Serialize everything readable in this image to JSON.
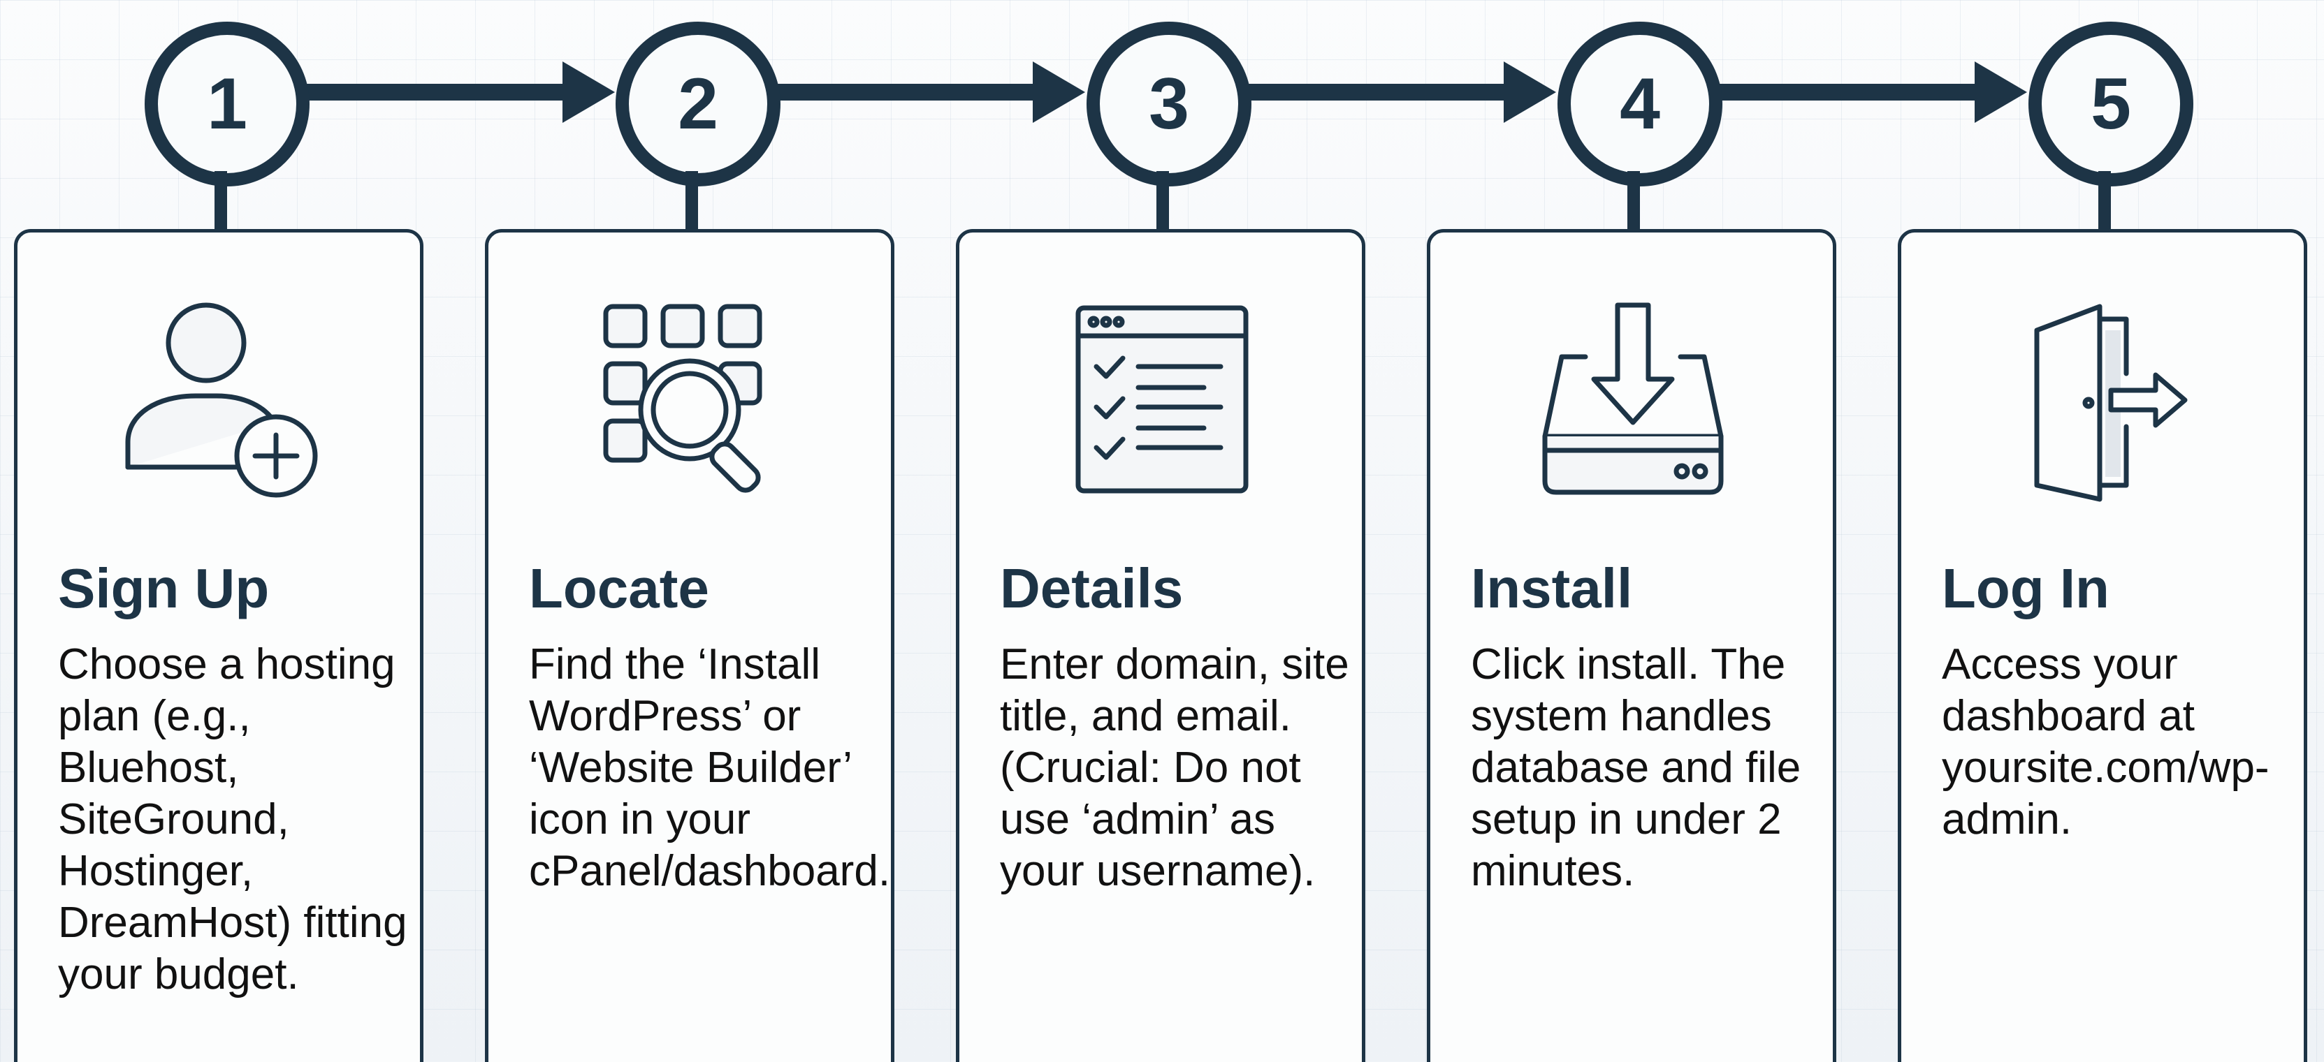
{
  "colors": {
    "primary": "#1d3446",
    "background": "#f3f6f9",
    "card": "#fcfdfd",
    "text": "#111111"
  },
  "steps": [
    {
      "number": "1",
      "icon": "user-add-icon",
      "title": "Sign Up",
      "body": "Choose a hosting\nplan (e.g.,\nBluehost,\nSiteGround,\nHostinger,\nDreamHost) fitting\nyour budget."
    },
    {
      "number": "2",
      "icon": "app-grid-search-icon",
      "title": "Locate",
      "body": "Find the ‘Install\nWordPress’ or\n‘Website Builder’\nicon in your\ncPanel/dashboard."
    },
    {
      "number": "3",
      "icon": "form-checklist-icon",
      "title": "Details",
      "body": "Enter domain, site\ntitle, and email.\n(Crucial: Do not\nuse ‘admin’ as\nyour username)."
    },
    {
      "number": "4",
      "icon": "download-drive-icon",
      "title": "Install",
      "body": "Click install. The\nsystem handles\ndatabase and file\nsetup in under 2\nminutes."
    },
    {
      "number": "5",
      "icon": "door-exit-icon",
      "title": "Log In",
      "body": "Access your\ndashboard at\nyoursite.com/wp-\nadmin."
    }
  ]
}
